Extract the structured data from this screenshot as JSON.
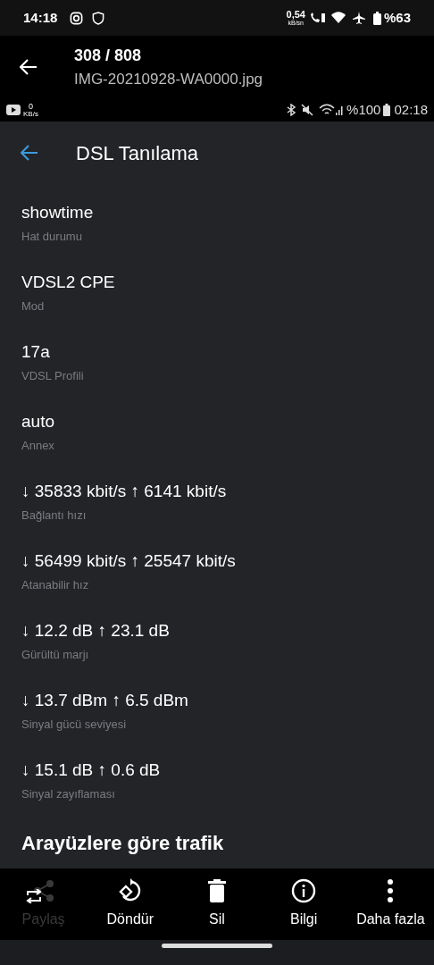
{
  "status_bar": {
    "time": "14:18",
    "net_speed": "0,54",
    "net_unit": "kB/sn",
    "battery": "%63"
  },
  "viewer_header": {
    "counter": "308 / 808",
    "filename": "IMG-20210928-WA0000.jpg"
  },
  "inner_status_bar": {
    "net_speed": "0",
    "net_unit": "KB/s",
    "battery": "%100",
    "time": "02:18"
  },
  "app": {
    "title": "DSL Tanılama",
    "items": [
      {
        "value": "showtime",
        "label": "Hat durumu"
      },
      {
        "value": "VDSL2 CPE",
        "label": "Mod"
      },
      {
        "value": "17a",
        "label": "VDSL Profili"
      },
      {
        "value": "auto",
        "label": "Annex"
      },
      {
        "value": "↓ 35833 kbit/s ↑ 6141 kbit/s",
        "label": "Bağlantı hızı"
      },
      {
        "value": "↓ 56499 kbit/s ↑ 25547 kbit/s",
        "label": "Atanabilir hız"
      },
      {
        "value": "↓ 12.2 dB ↑ 23.1 dB",
        "label": "Gürültü marjı"
      },
      {
        "value": "↓ 13.7 dBm ↑ 6.5 dBm",
        "label": "Sinyal gücü seviyesi"
      },
      {
        "value": "↓ 15.1 dB ↑ 0.6 dB",
        "label": "Sinyal zayıflaması"
      }
    ],
    "section_heading": "Arayüzlere göre trafik"
  },
  "actions": [
    {
      "kind": "share",
      "label": "Paylaş",
      "disabled": true
    },
    {
      "kind": "rotate",
      "label": "Döndür",
      "disabled": false
    },
    {
      "kind": "delete",
      "label": "Sil",
      "disabled": false
    },
    {
      "kind": "info",
      "label": "Bilgi",
      "disabled": false
    },
    {
      "kind": "more",
      "label": "Daha fazla",
      "disabled": false
    }
  ]
}
